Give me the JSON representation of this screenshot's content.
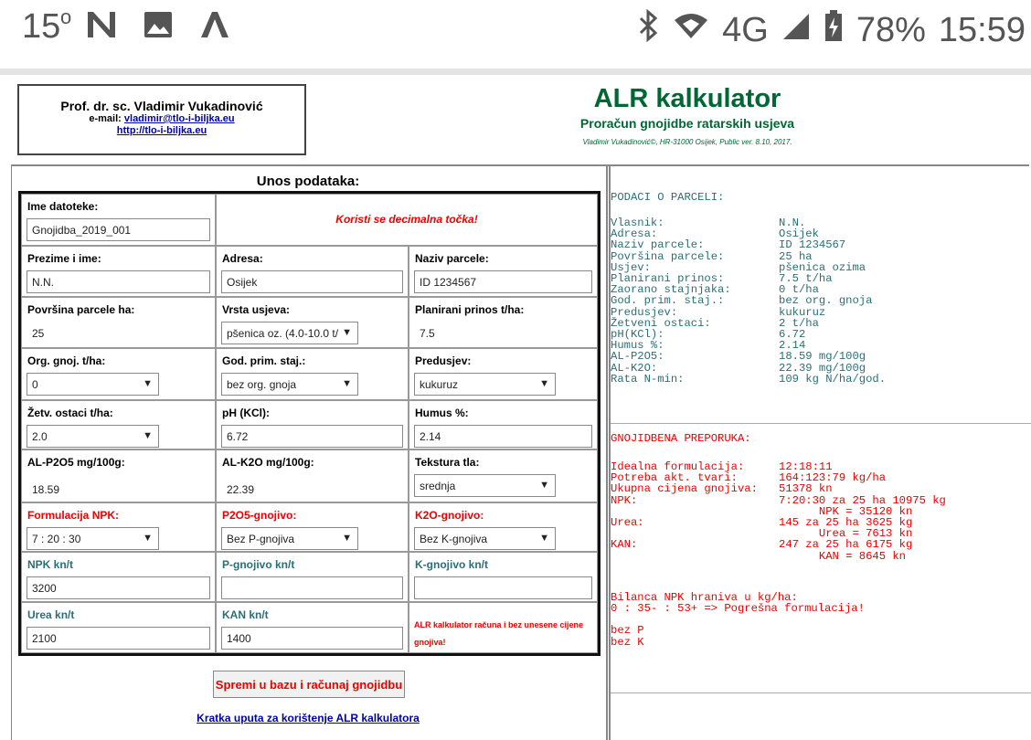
{
  "status_bar": {
    "temperature": "15",
    "temp_unit": "o",
    "network": "4G",
    "battery": "78%",
    "time": "15:59"
  },
  "header": {
    "author_name": "Prof. dr. sc. Vladimir Vukadinović",
    "email_label": "e-mail:",
    "email": "vladimir@tlo-i-biljka.eu",
    "url": "http://tlo-i-biljka.eu",
    "app_title": "ALR kalkulator",
    "app_subtitle": "Proračun gnojidbe ratarskih usjeva",
    "credit": "Vladimir Vukadinović©, HR-31000 Osijek, Public ver. 8.10, 2017."
  },
  "form": {
    "title": "Unos podataka:",
    "file_label": "Ime datoteke:",
    "file_value": "Gnojidba_2019_001",
    "decimal_note": "Koristi se decimalna točka!",
    "name_label": "Prezime i ime:",
    "name_value": "N.N.",
    "address_label": "Adresa:",
    "address_value": "Osijek",
    "parcel_label": "Naziv parcele:",
    "parcel_value": "ID 1234567",
    "area_label": "Površina parcele ha:",
    "area_value": "25",
    "crop_label": "Vrsta usjeva:",
    "crop_value": "pšenica oz. (4.0-10.0 t/",
    "yield_label": "Planirani prinos t/ha:",
    "yield_value": "7.5",
    "manure_label": "Org. gnoj. t/ha:",
    "manure_value": "0",
    "manure_year_label": "God. prim. staj.:",
    "manure_year_value": "bez org. gnoja",
    "precrop_label": "Predusjev:",
    "precrop_value": "kukuruz",
    "residue_label": "Žetv. ostaci t/ha:",
    "residue_value": "2.0",
    "ph_label": "pH (KCl):",
    "ph_value": "6.72",
    "humus_label": "Humus %:",
    "humus_value": "2.14",
    "p2o5_label": "AL-P2O5 mg/100g:",
    "p2o5_value": "18.59",
    "k2o_label": "AL-K2O mg/100g:",
    "k2o_value": "22.39",
    "texture_label": "Tekstura tla:",
    "texture_value": "srednja",
    "npk_form_label": "Formulacija NPK:",
    "npk_form_value": "7 : 20 : 30",
    "p_fert_label": "P2O5-gnojivo:",
    "p_fert_value": "Bez P-gnojiva",
    "k_fert_label": "K2O-gnojivo:",
    "k_fert_value": "Bez K-gnojiva",
    "npk_price_label": "NPK kn/t",
    "npk_price_value": "3200",
    "p_price_label": "P-gnojivo kn/t",
    "p_price_value": "",
    "k_price_label": "K-gnojivo kn/t",
    "k_price_value": "",
    "urea_price_label": "Urea kn/t",
    "urea_price_value": "2100",
    "kan_price_label": "KAN kn/t",
    "kan_price_value": "1400",
    "price_note": "ALR kalkulator računa i bez unesene cijene gnojiva!",
    "submit_label": "Spremi u bazu i računaj gnojidbu",
    "guide_link": "Kratka uputa za korištenje ALR kalkulatora"
  },
  "results": {
    "parcel_heading": "PODACI O PARCELI:",
    "parcel_rows": [
      {
        "k": "Vlasnik:",
        "v": "N.N."
      },
      {
        "k": "Adresa:",
        "v": "Osijek"
      },
      {
        "k": "Naziv parcele:",
        "v": "ID 1234567"
      },
      {
        "k": "Površina parcele:",
        "v": "25 ha"
      },
      {
        "k": "Usjev:",
        "v": "pšenica ozima"
      },
      {
        "k": "Planirani prinos:",
        "v": "7.5 t/ha"
      },
      {
        "k": "Zaorano stajnjaka:",
        "v": "0 t/ha"
      },
      {
        "k": "God. prim. staj.:",
        "v": "bez org. gnoja"
      },
      {
        "k": "Predusjev:",
        "v": "kukuruz"
      },
      {
        "k": "Žetveni ostaci:",
        "v": "2 t/ha"
      },
      {
        "k": "pH(KCl):",
        "v": "6.72"
      },
      {
        "k": "Humus %:",
        "v": "2.14"
      },
      {
        "k": "AL-P2O5:",
        "v": "18.59 mg/100g"
      },
      {
        "k": "AL-K2O:",
        "v": "22.39 mg/100g"
      },
      {
        "k": "Rata N-min:",
        "v": "109 kg N/ha/god."
      }
    ],
    "rec_heading": "GNOJIDBENA PREPORUKA:",
    "rec_rows": [
      {
        "k": "Idealna formulacija:",
        "v": "12:18:11"
      },
      {
        "k": "Potreba akt. tvari:",
        "v": "164:123:79 kg/ha"
      },
      {
        "k": "Ukupna cijena gnojiva:",
        "v": "51378 kn"
      },
      {
        "k": "NPK:",
        "v": "7:20:30 za 25 ha 10975 kg"
      },
      {
        "k": "",
        "v": "      NPK = 35120 kn"
      },
      {
        "k": "Urea:",
        "v": "145 za 25 ha 3625 kg"
      },
      {
        "k": "",
        "v": "      Urea = 7613 kn"
      },
      {
        "k": "KAN:",
        "v": "247 za 25 ha 6175 kg"
      },
      {
        "k": "",
        "v": "      KAN = 8645 kn"
      }
    ],
    "balance_title": "Bilanca NPK hraniva u kg/ha:",
    "balance_line": "0 : 35- : 53+  => Pogrešna formulacija!",
    "no_p": "bez P",
    "no_k": "bez K"
  }
}
